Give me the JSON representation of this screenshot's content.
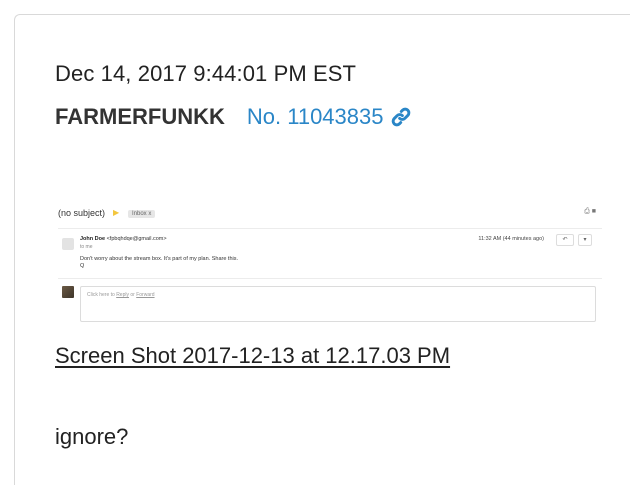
{
  "post": {
    "timestamp": "Dec 14, 2017 9:44:01 PM EST",
    "author": "FARMERFUNKK",
    "post_number": "No. 11043835",
    "link_icon": "link-icon",
    "attachment_name": "Screen Shot 2017-12-13 at 12.17.03 PM",
    "message": "ignore?"
  },
  "attachment_preview": {
    "subject": "(no subject)",
    "label": "Inbox x",
    "sender_name": "John Doe",
    "sender_email": "<fpbqhdqe@gmail.com>",
    "to": "to me",
    "body": "Don't worry about the stream box. It's part of my plan. Share this.",
    "sign": "Q",
    "time": "11:32 AM (44 minutes ago)",
    "reply_prompt_prefix": "Click here to",
    "reply_link": "Reply",
    "reply_mid": "or",
    "forward_link": "Forward"
  },
  "colors": {
    "link_blue": "#2a86c7",
    "text": "#222222"
  }
}
